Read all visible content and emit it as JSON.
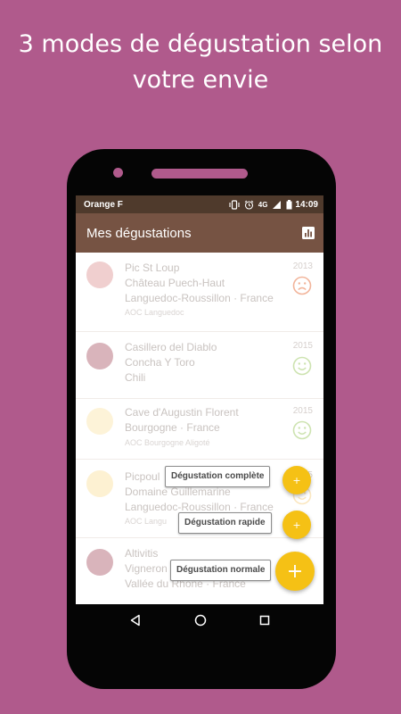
{
  "promo": {
    "heading_line1": "3 modes de dégustation selon",
    "heading_line2": "votre envie"
  },
  "statusbar": {
    "carrier": "Orange F",
    "network": "4G",
    "time": "14:09"
  },
  "appbar": {
    "title": "Mes dégustations",
    "stats_icon": "bar-chart-icon"
  },
  "tastings": [
    {
      "name": "Pic St Loup",
      "producer": "Château Puech-Haut",
      "region": "Languedoc-Roussillon · France",
      "appellation": "AOC Languedoc",
      "year": "2013",
      "mood": "sad",
      "color": "#f0cfcf"
    },
    {
      "name": "Casillero del Diablo",
      "producer": "Concha Y Toro",
      "region": "Chili",
      "appellation": "",
      "year": "2015",
      "mood": "happy",
      "color": "#d9b4bb"
    },
    {
      "name": "Cave d'Augustin Florent",
      "producer": "Bourgogne · France",
      "region": "",
      "appellation": "AOC Bourgogne Aligoté",
      "year": "2015",
      "mood": "happy",
      "color": "#fdf3d8"
    },
    {
      "name": "Picpoul",
      "producer": "Domaine Guillemarine",
      "region": "Languedoc-Roussillon · France",
      "appellation": "AOC Langu",
      "year": "2015",
      "mood": "happy",
      "color": "#fdf1d2"
    },
    {
      "name": "Altivitis",
      "producer": "Vigneron",
      "region": "Vallée du Rhône · France",
      "appellation": "",
      "year": "",
      "mood": "",
      "color": "#d9b4bb"
    }
  ],
  "fab_menu": {
    "complete_label": "Dégustation complète",
    "rapid_label": "Dégustation rapide",
    "normal_label": "Dégustation normale",
    "plus": "+"
  },
  "colors": {
    "background": "#b05a8c",
    "appbar": "#765343",
    "statusbar": "#4f3a2c",
    "fab": "#f5c115",
    "sad_face": "#f2b49a",
    "happy_face": "#cde3b0"
  }
}
